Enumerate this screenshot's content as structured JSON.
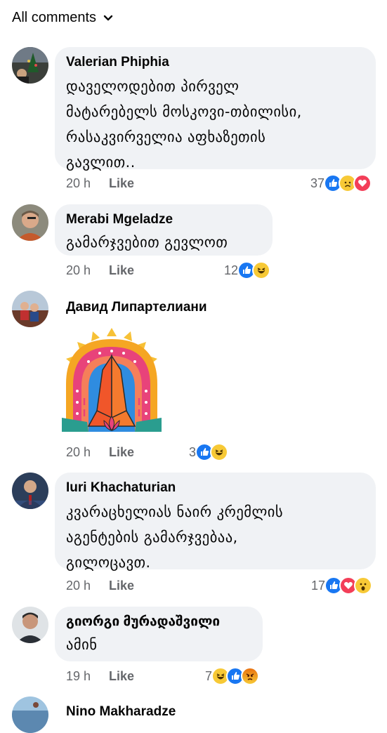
{
  "filter": {
    "label": "All comments"
  },
  "comments": [
    {
      "author": "Valerian Phiphia",
      "text": "დაველოდებით პირველ\nმატარებელს მოსკოვი-თბილისი,\nრასაკვირველია აფხაზეთის\nგავლით..",
      "time": "20 h",
      "like_label": "Like",
      "reaction_count": "37",
      "reactions": [
        "like-icon",
        "sad-icon",
        "love-icon"
      ]
    },
    {
      "author": "Merabi Mgeladze",
      "text": "გამარჯვებით გევლოთ",
      "time": "20 h",
      "like_label": "Like",
      "reaction_count": "12",
      "reactions": [
        "like-icon",
        "haha-icon"
      ]
    },
    {
      "author": "Давид Липартелиани",
      "sticker": "praying-hands-sticker",
      "time": "20 h",
      "like_label": "Like",
      "reaction_count": "3",
      "reactions": [
        "like-icon",
        "haha-icon"
      ]
    },
    {
      "author": "Iuri Khachaturian",
      "text": "კვარაცხელიას ნაირ კრემლის\nაგენტების გამარჯვებაა,\nგილოცავთ.",
      "time": "20 h",
      "like_label": "Like",
      "reaction_count": "17",
      "reactions": [
        "like-icon",
        "love-icon",
        "wow-icon"
      ]
    },
    {
      "author": "გიორგი მურადაშვილი",
      "text": "ამინ",
      "time": "19 h",
      "like_label": "Like",
      "reaction_count": "7",
      "reactions": [
        "haha-icon",
        "like-icon",
        "angry-icon"
      ]
    },
    {
      "author": "Nino Makharadze"
    }
  ]
}
